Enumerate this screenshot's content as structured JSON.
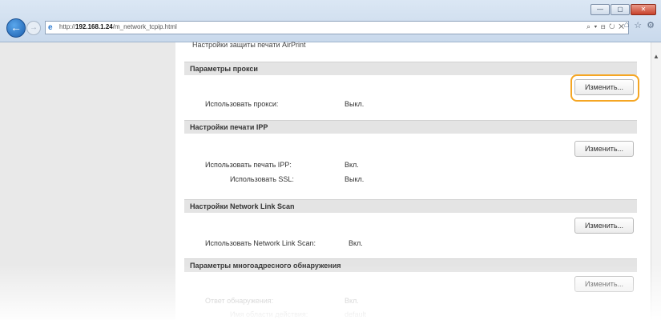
{
  "browser": {
    "url_prefix": "http://",
    "url_host": "192.168.1.24",
    "url_path": "/m_network_tcpip.html",
    "search_tools": "⌕ ▾ ⊟ ↻ ✕",
    "window_buttons": [
      "—",
      "▢",
      "✕"
    ]
  },
  "page": {
    "cutoff_text": "Настройки защиты печати AirPrint",
    "sections": [
      {
        "title": "Параметры прокси",
        "button": "Изменить...",
        "rows": [
          {
            "label": "Использовать прокси:",
            "value": "Выкл."
          }
        ]
      },
      {
        "title": "Настройки печати IPP",
        "button": "Изменить...",
        "rows": [
          {
            "label": "Использовать печать IPP:",
            "value": "Вкл."
          },
          {
            "label": "Использовать SSL:",
            "value": "Выкл."
          }
        ]
      },
      {
        "title": "Настройки Network Link Scan",
        "button": "Изменить...",
        "rows": [
          {
            "label": "Использовать Network Link Scan:",
            "value": "Вкл."
          }
        ]
      },
      {
        "title": "Параметры многоадресного обнаружения",
        "button": "Изменить...",
        "rows": [
          {
            "label": "Ответ обнаружения:",
            "value": "Вкл."
          },
          {
            "label": "Имя области действия:",
            "value": "default"
          }
        ]
      }
    ]
  }
}
